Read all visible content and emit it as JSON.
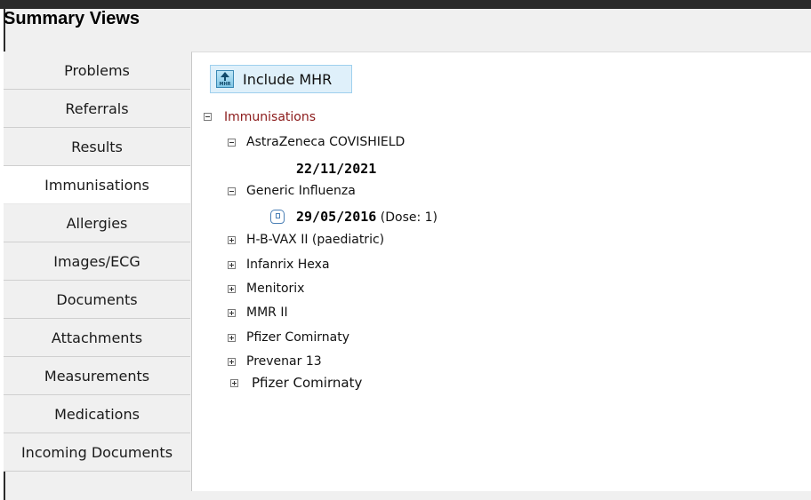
{
  "window": {
    "title": "Summary Views"
  },
  "tabs": [
    {
      "label": "Problems",
      "active": false
    },
    {
      "label": "Referrals",
      "active": false
    },
    {
      "label": "Results",
      "active": false
    },
    {
      "label": "Immunisations",
      "active": true
    },
    {
      "label": "Allergies",
      "active": false
    },
    {
      "label": "Images/ECG",
      "active": false
    },
    {
      "label": "Documents",
      "active": false
    },
    {
      "label": "Attachments",
      "active": false
    },
    {
      "label": "Measurements",
      "active": false
    },
    {
      "label": "Medications",
      "active": false
    },
    {
      "label": "Incoming Documents",
      "active": false
    }
  ],
  "toolbar": {
    "include_mhr_label": "Include MHR",
    "mhr_icon_text": "MHR"
  },
  "tree": {
    "root_label": "Immunisations",
    "items": [
      {
        "label": "AstraZeneca COVISHIELD",
        "expanded": true,
        "date": "22/11/2021"
      },
      {
        "label": "Generic Influenza",
        "expanded": true,
        "date": "29/05/2016",
        "dose": "(Dose: 1)"
      },
      {
        "label": "H-B-VAX II (paediatric)",
        "expanded": false
      },
      {
        "label": "Infanrix Hexa",
        "expanded": false
      },
      {
        "label": "Menitorix",
        "expanded": false
      },
      {
        "label": "MMR II",
        "expanded": false
      },
      {
        "label": "Pfizer Comirnaty",
        "expanded": false
      },
      {
        "label": "Prevenar 13",
        "expanded": false
      },
      {
        "label": "Pfizer Comirnaty",
        "expanded": false
      }
    ]
  }
}
